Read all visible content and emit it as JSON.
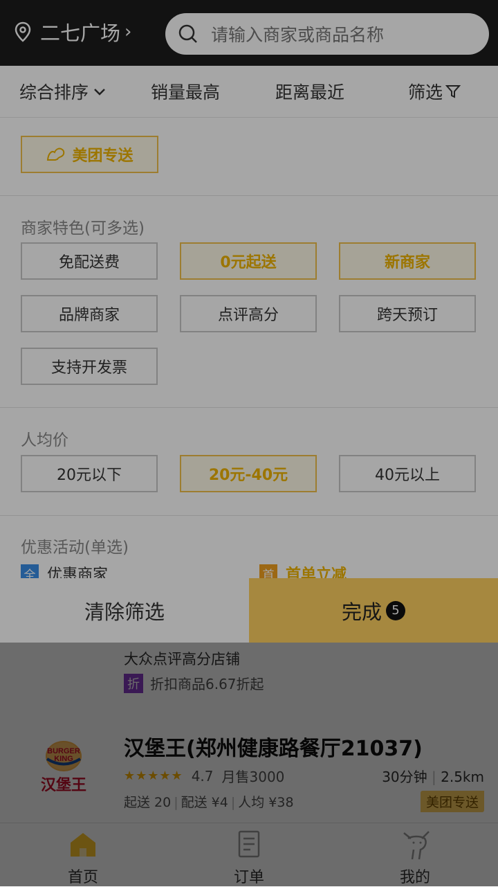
{
  "header": {
    "location": "二七广场",
    "search_placeholder": "请输入商家或商品名称"
  },
  "sort": {
    "items": [
      "综合排序",
      "销量最高",
      "距离最近",
      "筛选"
    ]
  },
  "filter": {
    "delivery_tag": "美团专送",
    "features_title": "商家特色(可多选)",
    "features": [
      {
        "label": "免配送费",
        "selected": false
      },
      {
        "label": "0元起送",
        "selected": true
      },
      {
        "label": "新商家",
        "selected": true
      },
      {
        "label": "品牌商家",
        "selected": false
      },
      {
        "label": "点评高分",
        "selected": false
      },
      {
        "label": "跨天预订",
        "selected": false
      },
      {
        "label": "支持开发票",
        "selected": false
      }
    ],
    "price_title": "人均价",
    "prices": [
      {
        "label": "20元以下",
        "selected": false
      },
      {
        "label": "20元-40元",
        "selected": true
      },
      {
        "label": "40元以上",
        "selected": false
      }
    ],
    "promo_title": "优惠活动(单选)",
    "promos": [
      {
        "badge": "全",
        "label": "优惠商家",
        "color": "#3a8ee6"
      },
      {
        "badge": "首",
        "label": "首单立减",
        "color": "#f0a020"
      }
    ],
    "clear_label": "清除筛选",
    "done_label": "完成",
    "done_count": "5"
  },
  "list": {
    "prev_line1": "大众点评高分店铺",
    "prev_badge": "折",
    "prev_line2": "折扣商品6.67折起",
    "restaurant": {
      "name": "汉堡王(郑州健康路餐厅21037)",
      "logo_text_top": "BURGER",
      "logo_text_bottom": "KING",
      "logo_caption": "汉堡王",
      "stars": "★★★★★",
      "score": "4.7",
      "sales": "月售3000",
      "time": "30分钟",
      "distance": "2.5km",
      "min_order": "起送 20",
      "delivery_fee": "配送 ¥4",
      "avg_price": "人均 ¥38",
      "tag": "美团专送"
    }
  },
  "tabs": [
    {
      "label": "首页",
      "active": true
    },
    {
      "label": "订单",
      "active": false
    },
    {
      "label": "我的",
      "active": false
    }
  ],
  "colors": {
    "accent": "#ffd161",
    "selected_text": "#f0b400"
  }
}
